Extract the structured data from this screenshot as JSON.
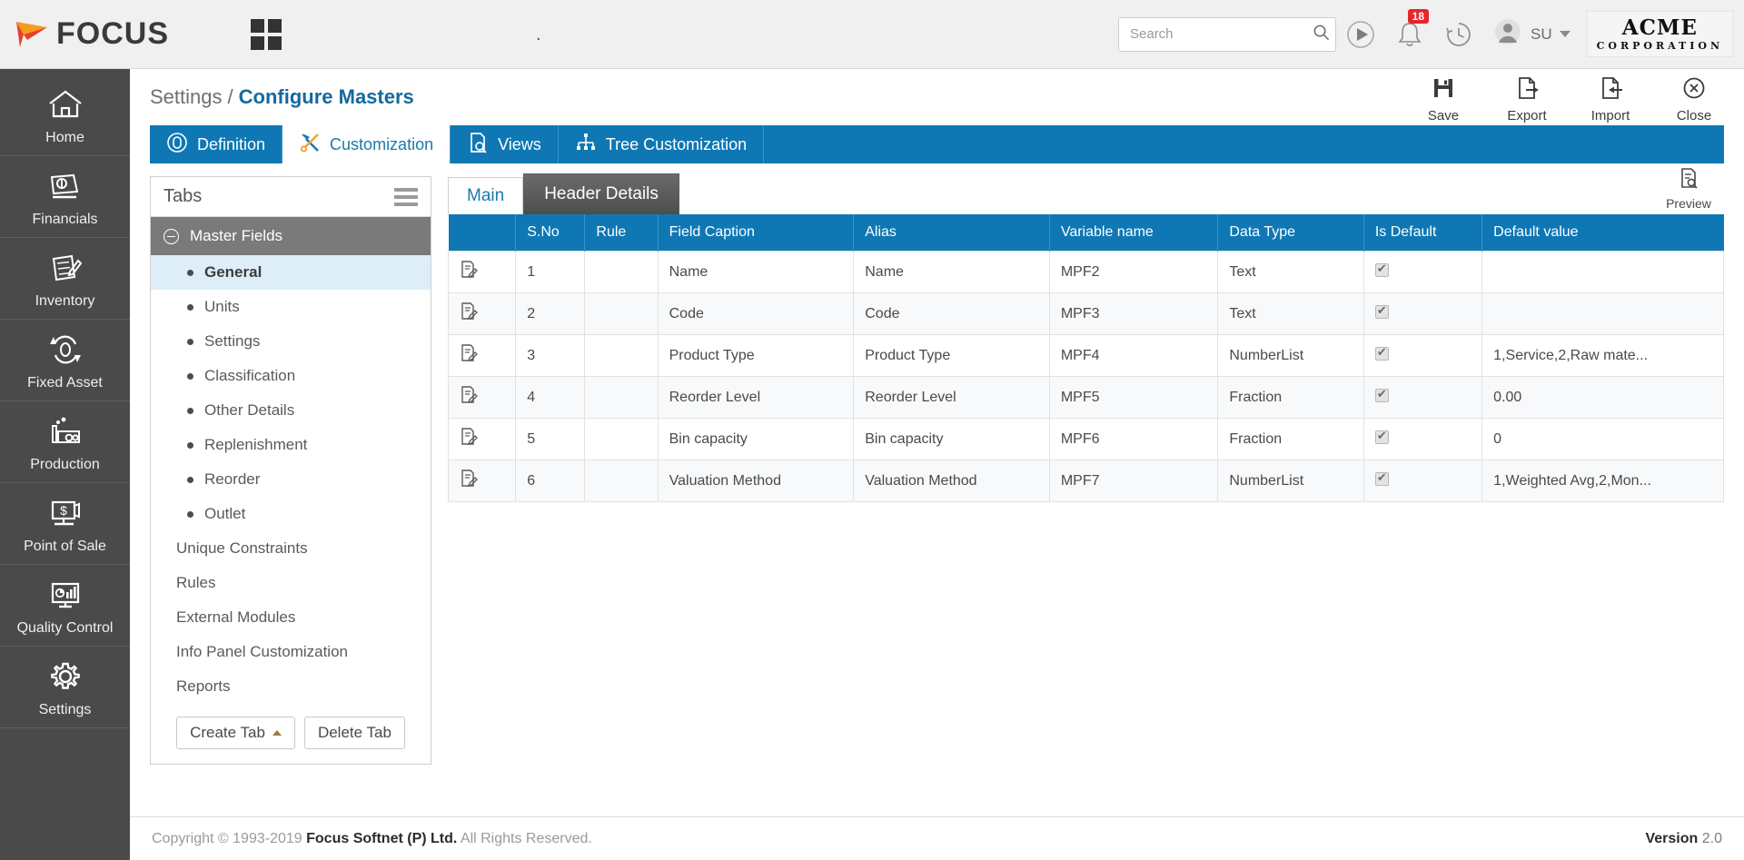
{
  "header": {
    "brand_text": "FOCUS",
    "apps_icon": "grid-apps-icon",
    "search": {
      "placeholder": "Search",
      "value": ""
    },
    "play_icon": "play-circle-icon",
    "notifications": {
      "icon": "bell-icon",
      "count": "18"
    },
    "history_icon": "clock-history-icon",
    "avatar_icon": "user-avatar-icon",
    "user_initials": "SU",
    "company": {
      "name": "ACME",
      "subtitle": "CORPORATION"
    }
  },
  "sidebar": {
    "items": [
      {
        "label": "Home",
        "icon": "home-icon"
      },
      {
        "label": "Financials",
        "icon": "money-bills-icon"
      },
      {
        "label": "Inventory",
        "icon": "inventory-list-pencil-icon"
      },
      {
        "label": "Fixed Asset",
        "icon": "asset-refresh-icon"
      },
      {
        "label": "Production",
        "icon": "factory-gear-icon"
      },
      {
        "label": "Point of Sale",
        "icon": "monitor-dollar-icon"
      },
      {
        "label": "Quality Control",
        "icon": "monitor-chart-icon"
      },
      {
        "label": "Settings",
        "icon": "gear-icon"
      }
    ]
  },
  "breadcrumb": {
    "parent": "Settings",
    "separator": "/",
    "current": "Configure Masters"
  },
  "actions": [
    {
      "label": "Save",
      "icon": "floppy-save-icon"
    },
    {
      "label": "Export",
      "icon": "file-export-icon"
    },
    {
      "label": "Import",
      "icon": "file-import-icon"
    },
    {
      "label": "Close",
      "icon": "close-circle-icon"
    }
  ],
  "main_tabs": [
    {
      "label": "Definition",
      "icon": "definition-badge-icon",
      "active": false
    },
    {
      "label": "Customization",
      "icon": "tools-wrench-screwdriver-icon",
      "active": true
    },
    {
      "label": "Views",
      "icon": "file-search-icon",
      "active": false
    },
    {
      "label": "Tree Customization",
      "icon": "hierarchy-tree-icon",
      "active": false
    }
  ],
  "tabs_panel": {
    "title": "Tabs",
    "menu_icon": "hamburger-icon",
    "group": {
      "label": "Master Fields",
      "toggle_icon": "circle-minus-icon"
    },
    "children": [
      {
        "label": "General",
        "selected": true
      },
      {
        "label": "Units",
        "selected": false
      },
      {
        "label": "Settings",
        "selected": false
      },
      {
        "label": "Classification",
        "selected": false
      },
      {
        "label": "Other Details",
        "selected": false
      },
      {
        "label": "Replenishment",
        "selected": false
      },
      {
        "label": "Reorder",
        "selected": false
      },
      {
        "label": "Outlet",
        "selected": false
      }
    ],
    "plain_items": [
      "Unique Constraints",
      "Rules",
      "External Modules",
      "Info Panel Customization",
      "Reports"
    ],
    "create_button": "Create Tab",
    "delete_button": "Delete Tab"
  },
  "right_pane": {
    "preview": {
      "label": "Preview",
      "icon": "preview-file-search-icon"
    },
    "sub_tabs": [
      {
        "label": "Main",
        "active": false
      },
      {
        "label": "Header Details",
        "active": true
      }
    ],
    "table": {
      "columns": [
        "",
        "S.No",
        "Rule",
        "Field Caption",
        "Alias",
        "Variable name",
        "Data Type",
        "Is Default",
        "Default value"
      ],
      "rows": [
        {
          "edit_icon": "edit-row-icon",
          "sno": "1",
          "rule": "",
          "caption": "Name",
          "alias": "Name",
          "variable": "MPF2",
          "datatype": "Text",
          "is_default": true,
          "default_value": ""
        },
        {
          "edit_icon": "edit-row-icon",
          "sno": "2",
          "rule": "",
          "caption": "Code",
          "alias": "Code",
          "variable": "MPF3",
          "datatype": "Text",
          "is_default": true,
          "default_value": ""
        },
        {
          "edit_icon": "edit-row-icon",
          "sno": "3",
          "rule": "",
          "caption": "Product Type",
          "alias": "Product Type",
          "variable": "MPF4",
          "datatype": "NumberList",
          "is_default": true,
          "default_value": "1,Service,2,Raw mate..."
        },
        {
          "edit_icon": "edit-row-icon",
          "sno": "4",
          "rule": "",
          "caption": "Reorder Level",
          "alias": "Reorder Level",
          "variable": "MPF5",
          "datatype": "Fraction",
          "is_default": true,
          "default_value": "0.00"
        },
        {
          "edit_icon": "edit-row-icon",
          "sno": "5",
          "rule": "",
          "caption": "Bin capacity",
          "alias": "Bin capacity",
          "variable": "MPF6",
          "datatype": "Fraction",
          "is_default": true,
          "default_value": "0"
        },
        {
          "edit_icon": "edit-row-icon",
          "sno": "6",
          "rule": "",
          "caption": "Valuation Method",
          "alias": "Valuation Method",
          "variable": "MPF7",
          "datatype": "NumberList",
          "is_default": true,
          "default_value": "1,Weighted Avg,2,Mon..."
        }
      ]
    }
  },
  "footer": {
    "copyright_prefix": "Copyright © 1993-2019 ",
    "copyright_company": "Focus Softnet (P) Ltd.",
    "copyright_suffix": " All Rights Reserved.",
    "version_label": "Version",
    "version_value": "2.0"
  },
  "colors": {
    "accent_blue": "#0f78b4",
    "sidebar_dark": "#4a4a4a",
    "badge_red": "#e8232a",
    "selected_row": "#ddeef8"
  }
}
